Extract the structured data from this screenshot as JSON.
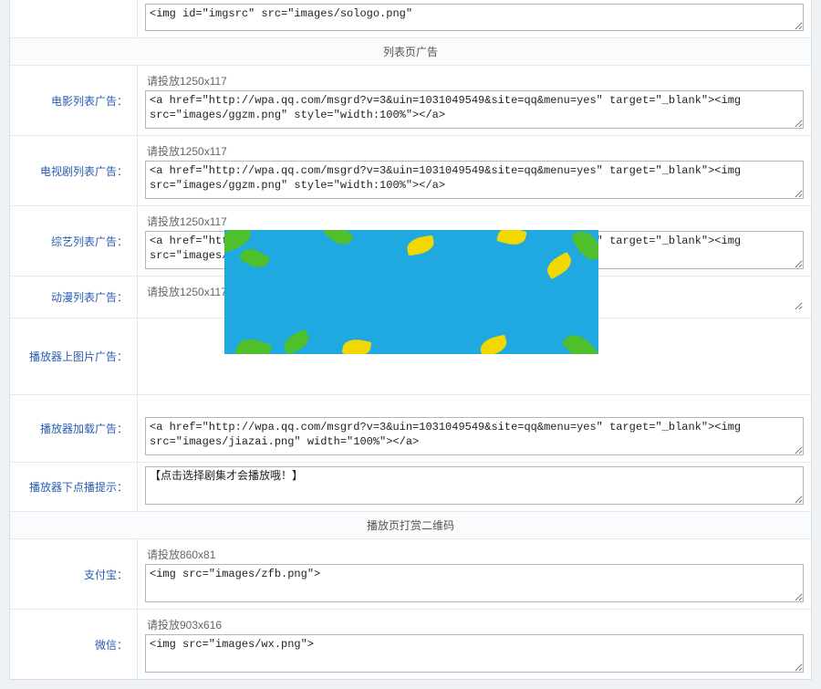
{
  "top_textarea": "<img id=\"imgsrc\" src=\"images/sologo.png\"",
  "sections": {
    "list_page_title": "列表页广告",
    "player_qr_title": "播放页打赏二维码"
  },
  "rows": {
    "movie_list": {
      "label": "电影列表广告：",
      "hint": "请投放1250x117",
      "value": "<a href=\"http://wpa.qq.com/msgrd?v=3&uin=1031049549&site=qq&menu=yes\" target=\"_blank\"><img src=\"images/ggzm.png\" style=\"width:100%\"></a>"
    },
    "tv_list": {
      "label": "电视剧列表广告：",
      "hint": "请投放1250x117",
      "value": "<a href=\"http://wpa.qq.com/msgrd?v=3&uin=1031049549&site=qq&menu=yes\" target=\"_blank\"><img src=\"images/ggzm.png\" style=\"width:100%\"></a>"
    },
    "variety_list": {
      "label": "综艺列表广告：",
      "hint": "请投放1250x117",
      "value": "<a href=\"http://wpa.qq.com/msgrd?v=3&uin=1031049549&site=qq&menu=yes\" target=\"_blank\"><img src=\"images/ggzm.png\" style=\"width:100%\"></a>"
    },
    "anime_list": {
      "label": "动漫列表广告：",
      "hint": "请投放1250x117",
      "value": ""
    },
    "player_top_img": {
      "label": "播放器上图片广告：",
      "hint": "",
      "value": ""
    },
    "player_loading": {
      "label": "播放器加载广告：",
      "hint": "",
      "value": "<a href=\"http://wpa.qq.com/msgrd?v=3&uin=1031049549&site=qq&menu=yes\" target=\"_blank\"><img src=\"images/jiazai.png\" width=\"100%\"></a>"
    },
    "player_vod_tip": {
      "label": "播放器下点播提示：",
      "value": "【点击选择剧集才会播放哦！】"
    },
    "alipay": {
      "label": "支付宝：",
      "hint": "请投放860x81",
      "value": "<img src=\"images/zfb.png\">"
    },
    "wechat": {
      "label": "微信：",
      "hint": "请投放903x616",
      "value": "<img src=\"images/wx.png\">"
    }
  }
}
